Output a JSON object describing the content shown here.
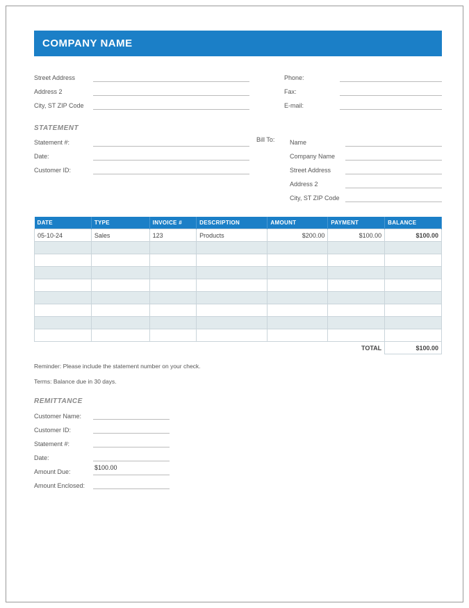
{
  "header": {
    "company_name": "COMPANY NAME"
  },
  "address_block": {
    "street": {
      "label": "Street Address",
      "value": ""
    },
    "address2": {
      "label": "Address 2",
      "value": ""
    },
    "city": {
      "label": "City, ST ZIP Code",
      "value": ""
    }
  },
  "contact_block": {
    "phone": {
      "label": "Phone:",
      "value": ""
    },
    "fax": {
      "label": "Fax:",
      "value": ""
    },
    "email": {
      "label": "E-mail:",
      "value": ""
    }
  },
  "statement_heading": "STATEMENT",
  "statement_block": {
    "number": {
      "label": "Statement #:",
      "value": ""
    },
    "date": {
      "label": "Date:",
      "value": ""
    },
    "customer_id": {
      "label": "Customer ID:",
      "value": ""
    }
  },
  "bill_to_heading": "Bill To:",
  "bill_to": {
    "name": {
      "label": "Name",
      "value": ""
    },
    "company": {
      "label": "Company Name",
      "value": ""
    },
    "street": {
      "label": "Street Address",
      "value": ""
    },
    "address2": {
      "label": "Address 2",
      "value": ""
    },
    "city": {
      "label": "City, ST ZIP Code",
      "value": ""
    }
  },
  "ledger": {
    "columns": [
      "DATE",
      "TYPE",
      "INVOICE #",
      "DESCRIPTION",
      "AMOUNT",
      "PAYMENT",
      "BALANCE"
    ],
    "rows": [
      {
        "date": "05-10-24",
        "type": "Sales",
        "invoice": "123",
        "description": "Products",
        "amount": "$200.00",
        "payment": "$100.00",
        "balance": "$100.00"
      },
      {
        "date": "",
        "type": "",
        "invoice": "",
        "description": "",
        "amount": "",
        "payment": "",
        "balance": ""
      },
      {
        "date": "",
        "type": "",
        "invoice": "",
        "description": "",
        "amount": "",
        "payment": "",
        "balance": ""
      },
      {
        "date": "",
        "type": "",
        "invoice": "",
        "description": "",
        "amount": "",
        "payment": "",
        "balance": ""
      },
      {
        "date": "",
        "type": "",
        "invoice": "",
        "description": "",
        "amount": "",
        "payment": "",
        "balance": ""
      },
      {
        "date": "",
        "type": "",
        "invoice": "",
        "description": "",
        "amount": "",
        "payment": "",
        "balance": ""
      },
      {
        "date": "",
        "type": "",
        "invoice": "",
        "description": "",
        "amount": "",
        "payment": "",
        "balance": ""
      },
      {
        "date": "",
        "type": "",
        "invoice": "",
        "description": "",
        "amount": "",
        "payment": "",
        "balance": ""
      },
      {
        "date": "",
        "type": "",
        "invoice": "",
        "description": "",
        "amount": "",
        "payment": "",
        "balance": ""
      }
    ],
    "total_label": "TOTAL",
    "total_value": "$100.00"
  },
  "reminder": "Reminder: Please include the statement number on your check.",
  "terms": "Terms: Balance due in 30 days.",
  "remittance_heading": "REMITTANCE",
  "remittance": {
    "customer_name": {
      "label": "Customer Name:",
      "value": ""
    },
    "customer_id": {
      "label": "Customer ID:",
      "value": ""
    },
    "statement": {
      "label": "Statement #:",
      "value": ""
    },
    "date": {
      "label": "Date:",
      "value": ""
    },
    "amount_due": {
      "label": "Amount Due:",
      "value": "$100.00"
    },
    "amount_enclosed": {
      "label": "Amount Enclosed:",
      "value": ""
    }
  }
}
